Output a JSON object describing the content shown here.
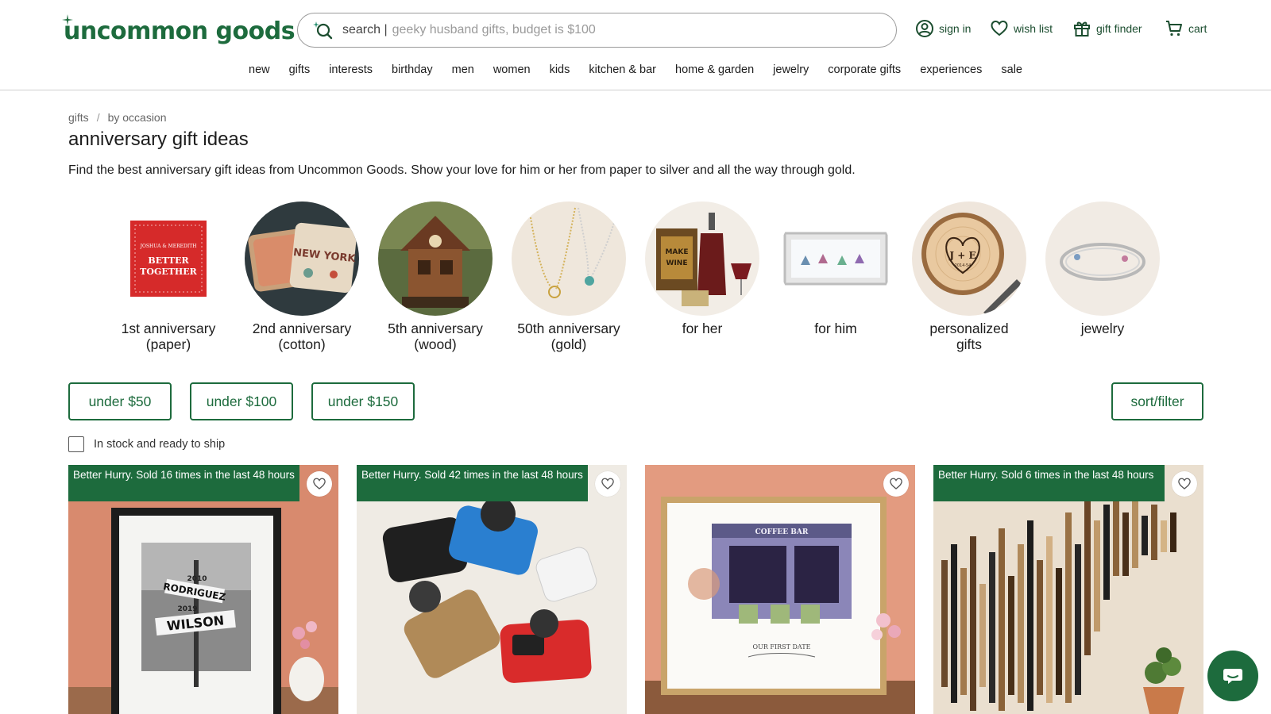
{
  "brand": {
    "logo_text": "uncommon goods",
    "accent": "#1d6b3d"
  },
  "search": {
    "label": "search |",
    "placeholder": "geeky husband gifts, budget is $100"
  },
  "utility": {
    "sign_in": "sign in",
    "wish_list": "wish list",
    "gift_finder": "gift finder",
    "cart": "cart"
  },
  "nav": [
    "new",
    "gifts",
    "interests",
    "birthday",
    "men",
    "women",
    "kids",
    "kitchen & bar",
    "home & garden",
    "jewelry",
    "corporate gifts",
    "experiences",
    "sale"
  ],
  "breadcrumb": {
    "items": [
      "gifts",
      "by occasion"
    ],
    "separator": "/"
  },
  "page": {
    "title": "anniversary gift ideas",
    "description": "Find the best anniversary gift ideas from Uncommon Goods. Show your love for him or her from paper to silver and all the way through gold."
  },
  "categories": [
    {
      "label": "1st anniversary\n(paper)",
      "image_text_1": "JOSHUA & MEREDITH",
      "image_text_2": "BETTER",
      "image_text_3": "TOGETHER"
    },
    {
      "label": "2nd anniversary\n(cotton)",
      "image_text_1": "NEW YORK"
    },
    {
      "label": "5th anniversary\n(wood)"
    },
    {
      "label": "50th anniversary\n(gold)"
    },
    {
      "label": "for her",
      "image_text_1": "MAKE",
      "image_text_2": "WINE"
    },
    {
      "label": "for him"
    },
    {
      "label": "personalized\ngifts",
      "image_text_1": "J + E",
      "image_text_2": "2014·54"
    },
    {
      "label": "jewelry"
    }
  ],
  "price_filters": [
    "under $50",
    "under $100",
    "under $150"
  ],
  "sort_filter": "sort/filter",
  "stock_filter": {
    "label": "In stock and ready to ship",
    "checked": false
  },
  "products": [
    {
      "badge": "Better Hurry. Sold 16 times in the last 48 hours",
      "image_text": [
        "2010",
        "RODRIGUEZ",
        "2019",
        "WILSON"
      ]
    },
    {
      "badge": "Better Hurry. Sold 42 times in the last 48 hours"
    },
    {
      "badge": "",
      "image_text": [
        "COFFEE BAR",
        "OUR FIRST DATE"
      ]
    },
    {
      "badge": "Better Hurry. Sold 6 times in the last 48 hours"
    }
  ]
}
